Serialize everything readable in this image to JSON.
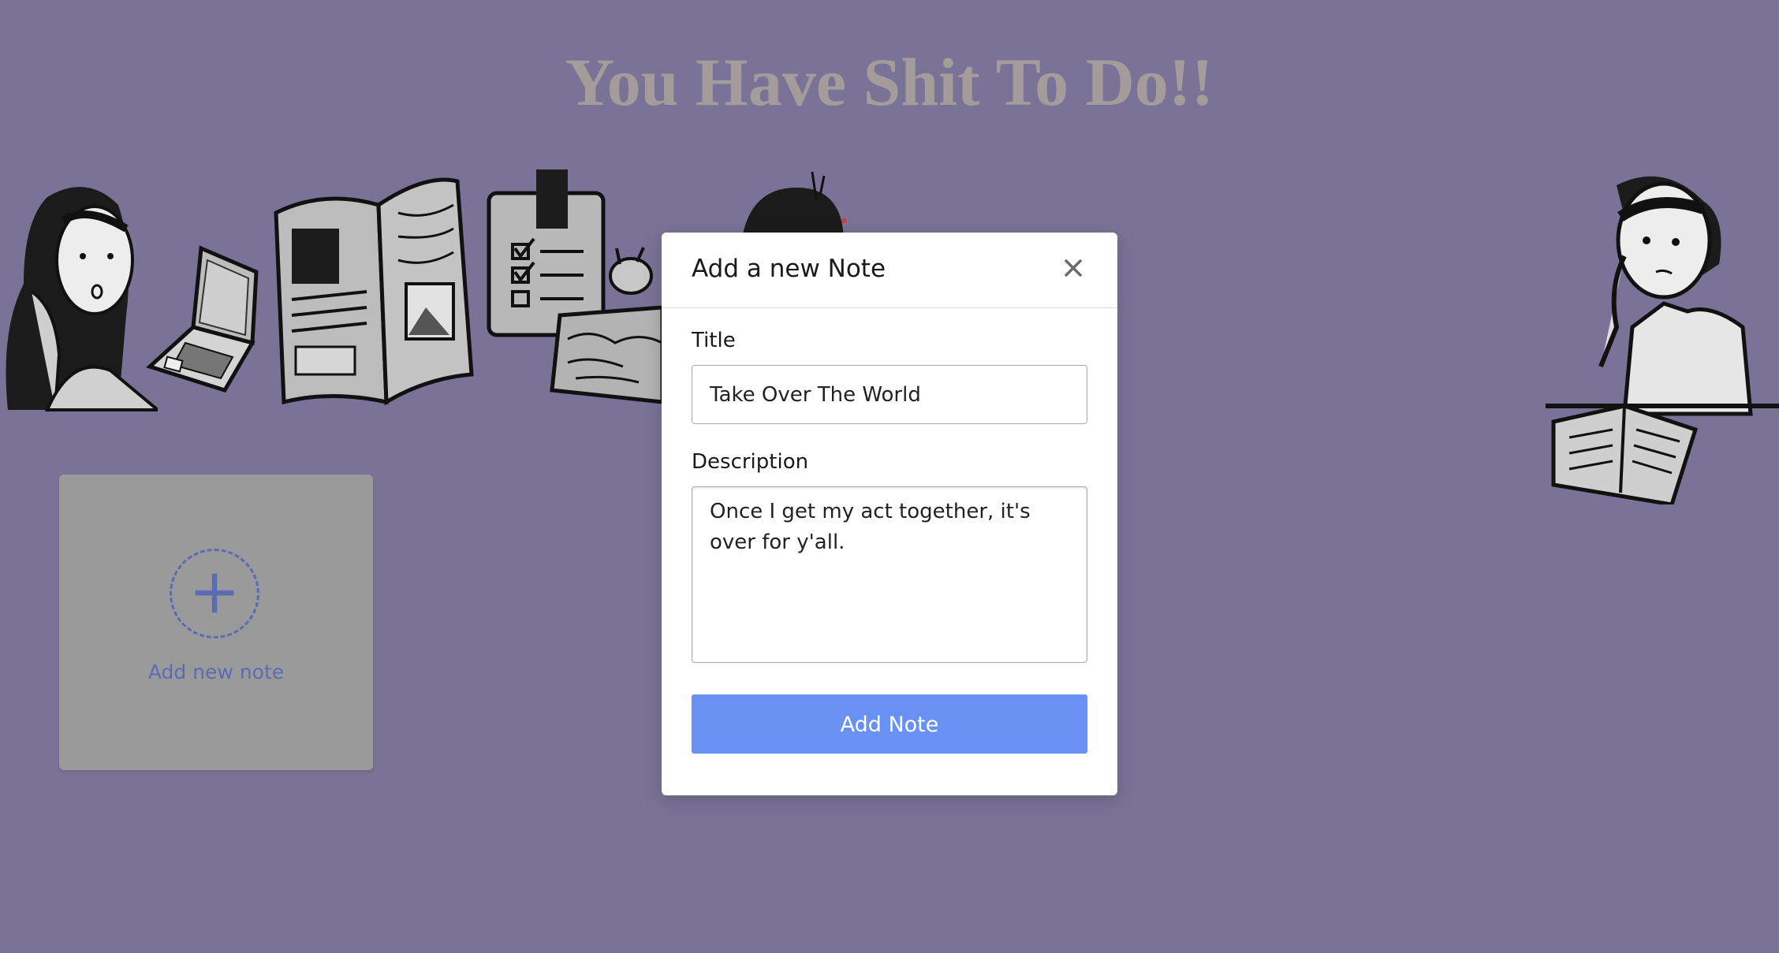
{
  "page": {
    "title": "You Have Shit To Do!!"
  },
  "add_card": {
    "label": "Add new note",
    "plus": "+"
  },
  "modal": {
    "title": "Add a new Note",
    "close_symbol": "×",
    "title_field": {
      "label": "Title",
      "value": "Take Over The World"
    },
    "description_field": {
      "label": "Description",
      "value": "Once I get my act together, it's over for y'all."
    },
    "submit_label": "Add Note"
  },
  "icons": {
    "close": "close-icon",
    "add": "plus-icon"
  },
  "colors": {
    "background": "#7b7397",
    "title": "#a39c9a",
    "accent": "#6991f5",
    "add_card_accent": "#5b6cb5",
    "card": "#9a9a9a"
  }
}
